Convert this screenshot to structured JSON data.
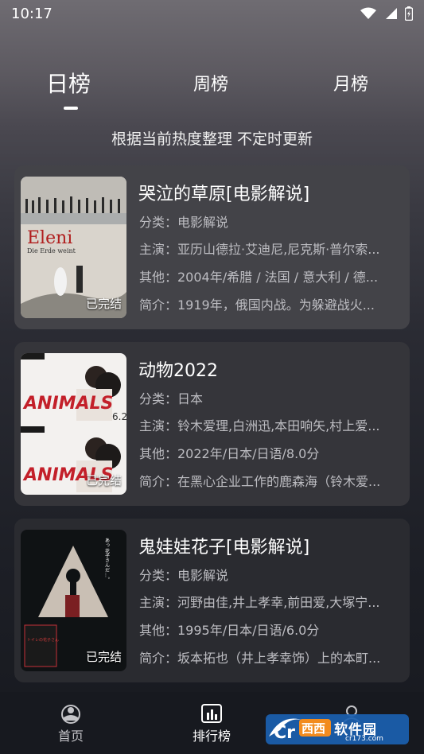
{
  "status_bar": {
    "time": "10:17"
  },
  "tabs": [
    {
      "label": "日榜",
      "active": true
    },
    {
      "label": "周榜",
      "active": false
    },
    {
      "label": "月榜",
      "active": false
    }
  ],
  "subtitle": "根据当前热度整理 不定时更新",
  "items": [
    {
      "title": "哭泣的草原[电影解说]",
      "category": "分类：电影解说",
      "cast": "主演：亚历山德拉·艾迪尼,尼克斯·普尔索...",
      "other": "其他：2004年/希腊 / 法国 / 意大利 / 德...",
      "summary": "简介：1919年，俄国内战。为躲避战火...",
      "badge": "已完结",
      "poster_title": "Eleni",
      "poster_subtitle": "Die Erde weint"
    },
    {
      "title": "动物2022",
      "category": "分类：日本",
      "cast": "主演：铃木爱理,白洲迅,本田响矢,村上爱...",
      "other": "其他：2022年/日本/日语/8.0分",
      "summary": "简介：在黑心企业工作的鹿森海（铃木爱...",
      "badge": "已完结",
      "poster_title": "ANIMALS",
      "poster_subtitle": "6.2"
    },
    {
      "title": "鬼娃娃花子[电影解说]",
      "category": "分类：电影解说",
      "cast": "主演：河野由佳,井上孝幸,前田爱,大塚宁...",
      "other": "其他：1995年/日本/日语/6.0分",
      "summary": "简介：坂本拓也（井上孝幸饰）上的本町...",
      "badge": "已完结",
      "poster_title": "トイレの花子さん",
      "poster_subtitle": "あっ 花子さんだ…。"
    }
  ],
  "bottom_nav": [
    {
      "label": "首页",
      "icon": "home-icon",
      "active": false
    },
    {
      "label": "排行榜",
      "icon": "ranking-icon",
      "active": true
    },
    {
      "label": "",
      "icon": "user-icon",
      "active": false
    }
  ],
  "watermark": {
    "brand": "软件园",
    "prefix": "西西",
    "url": "cr173.com"
  },
  "colors": {
    "accent": "#ffffff",
    "card_bg": "#434348",
    "nav_bg": "#17191f",
    "text_secondary": "#bdbdc2"
  }
}
